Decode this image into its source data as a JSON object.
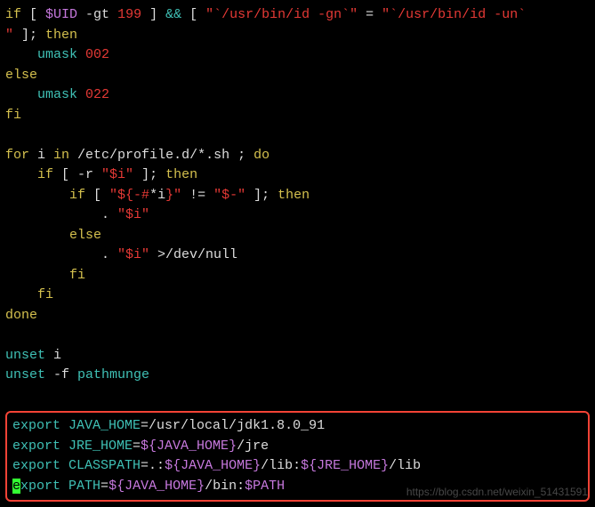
{
  "code": {
    "l1": {
      "p1": "if",
      "p2": " [ ",
      "p3": "$UID",
      "p4": " -gt ",
      "p5": "199",
      "p6": " ] ",
      "p7": "&&",
      "p8": " [ ",
      "p9": "\"`/usr/bin/id -gn`\"",
      "p10": " = ",
      "p11": "\"`/usr/bin/id -un`"
    },
    "l2": {
      "p1": "\"",
      "p2": " ]; ",
      "p3": "then"
    },
    "l3": {
      "p1": "    ",
      "p2": "umask",
      "p3": " 002"
    },
    "l4": {
      "p1": "else"
    },
    "l5": {
      "p1": "    ",
      "p2": "umask",
      "p3": " 022"
    },
    "l6": {
      "p1": "fi"
    },
    "l7": {
      "p1": ""
    },
    "l8": {
      "p1": "for",
      "p2": " i ",
      "p3": "in",
      "p4": " /etc/profile.d/*.sh ; ",
      "p5": "do"
    },
    "l9": {
      "p1": "    ",
      "p2": "if",
      "p3": " [ -r ",
      "p4": "\"$i\"",
      "p5": " ]; ",
      "p6": "then"
    },
    "l10": {
      "p1": "        ",
      "p2": "if",
      "p3": " [ ",
      "p4": "\"${-#",
      "p5": "*i",
      "p6": "}\"",
      "p7": " != ",
      "p8": "\"$-\"",
      "p9": " ]; ",
      "p10": "then"
    },
    "l11": {
      "p1": "            . ",
      "p2": "\"$i\""
    },
    "l12": {
      "p1": "        ",
      "p2": "else"
    },
    "l13": {
      "p1": "            . ",
      "p2": "\"$i\"",
      "p3": " >/dev/null"
    },
    "l14": {
      "p1": "        ",
      "p2": "fi"
    },
    "l15": {
      "p1": "    ",
      "p2": "fi"
    },
    "l16": {
      "p1": "done"
    },
    "l17": {
      "p1": ""
    },
    "l18": {
      "p1": "unset",
      "p2": " i"
    },
    "l19": {
      "p1": "unset",
      "p2": " -f ",
      "p3": "pathmunge"
    },
    "l20": {
      "p1": ""
    },
    "box": {
      "b1": {
        "p1": "export",
        "p2": " JAVA_HOME",
        "p3": "=",
        "p4": "/usr/local/jdk1.8.0_91"
      },
      "b2": {
        "p1": "export",
        "p2": " JRE_HOME",
        "p3": "=",
        "p4": "${JAVA_HOME}",
        "p5": "/jre"
      },
      "b3": {
        "p1": "export",
        "p2": " CLASSPATH",
        "p3": "=",
        "p4": ".:",
        "p5": "${JAVA_HOME}",
        "p6": "/lib:",
        "p7": "${JRE_HOME}",
        "p8": "/lib"
      },
      "b4": {
        "c": "e",
        "p1": "xport",
        "p2": " PATH",
        "p3": "=",
        "p4": "${JAVA_HOME}",
        "p5": "/bin:",
        "p6": "$PATH"
      }
    }
  },
  "watermark": "https://blog.csdn.net/weixin_51431591"
}
